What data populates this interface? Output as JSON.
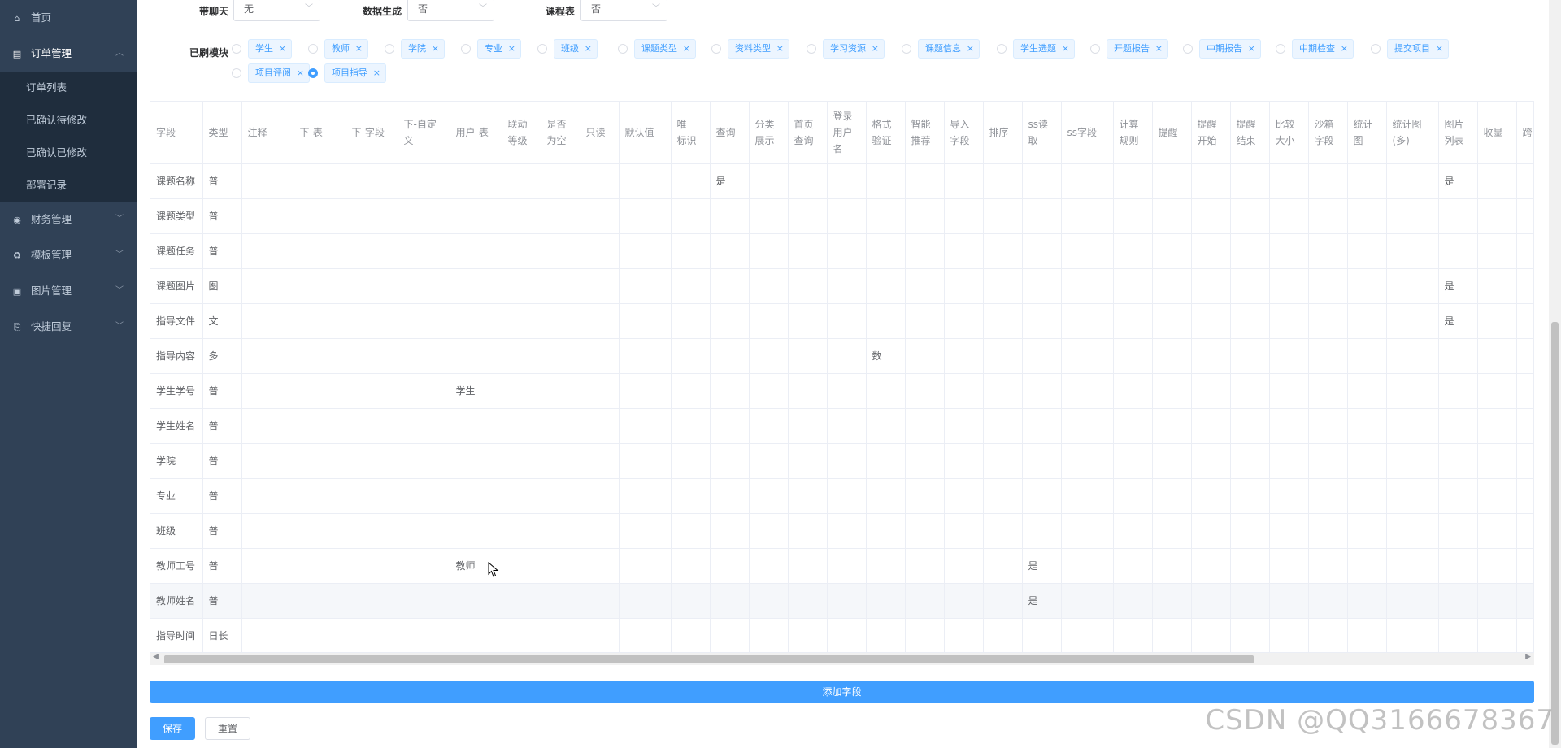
{
  "sidebar": {
    "items": [
      {
        "label": "首页",
        "icon": "home-icon"
      },
      {
        "label": "订单管理",
        "icon": "document-icon",
        "expanded": true,
        "children": [
          "订单列表",
          "已确认待修改",
          "已确认已修改",
          "部署记录"
        ]
      },
      {
        "label": "财务管理",
        "icon": "finance-icon"
      },
      {
        "label": "模板管理",
        "icon": "template-icon"
      },
      {
        "label": "图片管理",
        "icon": "image-icon"
      },
      {
        "label": "快捷回复",
        "icon": "reply-icon"
      }
    ]
  },
  "form": {
    "chat_label": "带聊天",
    "chat_value": "无",
    "datagen_label": "数据生成",
    "datagen_value": "否",
    "schedule_label": "课程表",
    "schedule_value": "否",
    "modules_label": "已刷模块"
  },
  "modules": [
    {
      "label": "学生",
      "checked": false
    },
    {
      "label": "教师",
      "checked": false
    },
    {
      "label": "学院",
      "checked": false
    },
    {
      "label": "专业",
      "checked": false
    },
    {
      "label": "班级",
      "checked": false
    },
    {
      "label": "课题类型",
      "checked": false
    },
    {
      "label": "资料类型",
      "checked": false
    },
    {
      "label": "学习资源",
      "checked": false
    },
    {
      "label": "课题信息",
      "checked": false
    },
    {
      "label": "学生选题",
      "checked": false
    },
    {
      "label": "开题报告",
      "checked": false
    },
    {
      "label": "中期报告",
      "checked": false
    },
    {
      "label": "中期检查",
      "checked": false
    },
    {
      "label": "提交项目",
      "checked": false
    },
    {
      "label": "项目评阅",
      "checked": false
    },
    {
      "label": "项目指导",
      "checked": true
    }
  ],
  "table": {
    "headers": [
      "字段",
      "类型",
      "注释",
      "下-表",
      "下-字段",
      "下-自定义",
      "用户-表",
      "联动等级",
      "是否为空",
      "只读",
      "默认值",
      "唯一标识",
      "查询",
      "分类展示",
      "首页查询",
      "登录用户名",
      "格式验证",
      "智能推荐",
      "导入字段",
      "排序",
      "ss读取",
      "ss字段",
      "计算规则",
      "提醒",
      "提醒开始",
      "提醒结束",
      "比较大小",
      "沙箱字段",
      "统计图",
      "统计图(多)",
      "图片列表",
      "收显",
      "跨计"
    ],
    "rows": [
      [
        "课题名称",
        "普",
        "",
        "",
        "",
        "",
        "",
        "",
        "",
        "",
        "",
        "",
        "是",
        "",
        "",
        "",
        "",
        "",
        "",
        "",
        "",
        "",
        "",
        "",
        "",
        "",
        "",
        "",
        "",
        "",
        "是",
        "",
        ""
      ],
      [
        "课题类型",
        "普",
        "",
        "",
        "",
        "",
        "",
        "",
        "",
        "",
        "",
        "",
        "",
        "",
        "",
        "",
        "",
        "",
        "",
        "",
        "",
        "",
        "",
        "",
        "",
        "",
        "",
        "",
        "",
        "",
        "",
        "",
        ""
      ],
      [
        "课题任务",
        "普",
        "",
        "",
        "",
        "",
        "",
        "",
        "",
        "",
        "",
        "",
        "",
        "",
        "",
        "",
        "",
        "",
        "",
        "",
        "",
        "",
        "",
        "",
        "",
        "",
        "",
        "",
        "",
        "",
        "",
        "",
        ""
      ],
      [
        "课题图片",
        "图",
        "",
        "",
        "",
        "",
        "",
        "",
        "",
        "",
        "",
        "",
        "",
        "",
        "",
        "",
        "",
        "",
        "",
        "",
        "",
        "",
        "",
        "",
        "",
        "",
        "",
        "",
        "",
        "",
        "是",
        "",
        ""
      ],
      [
        "指导文件",
        "文",
        "",
        "",
        "",
        "",
        "",
        "",
        "",
        "",
        "",
        "",
        "",
        "",
        "",
        "",
        "",
        "",
        "",
        "",
        "",
        "",
        "",
        "",
        "",
        "",
        "",
        "",
        "",
        "",
        "是",
        "",
        ""
      ],
      [
        "指导内容",
        "多",
        "",
        "",
        "",
        "",
        "",
        "",
        "",
        "",
        "",
        "",
        "",
        "",
        "",
        "",
        "数",
        "",
        "",
        "",
        "",
        "",
        "",
        "",
        "",
        "",
        "",
        "",
        "",
        "",
        "",
        "",
        ""
      ],
      [
        "学生学号",
        "普",
        "",
        "",
        "",
        "",
        "学生",
        "",
        "",
        "",
        "",
        "",
        "",
        "",
        "",
        "",
        "",
        "",
        "",
        "",
        "",
        "",
        "",
        "",
        "",
        "",
        "",
        "",
        "",
        "",
        "",
        "",
        ""
      ],
      [
        "学生姓名",
        "普",
        "",
        "",
        "",
        "",
        "",
        "",
        "",
        "",
        "",
        "",
        "",
        "",
        "",
        "",
        "",
        "",
        "",
        "",
        "",
        "",
        "",
        "",
        "",
        "",
        "",
        "",
        "",
        "",
        "",
        "",
        ""
      ],
      [
        "学院",
        "普",
        "",
        "",
        "",
        "",
        "",
        "",
        "",
        "",
        "",
        "",
        "",
        "",
        "",
        "",
        "",
        "",
        "",
        "",
        "",
        "",
        "",
        "",
        "",
        "",
        "",
        "",
        "",
        "",
        "",
        "",
        ""
      ],
      [
        "专业",
        "普",
        "",
        "",
        "",
        "",
        "",
        "",
        "",
        "",
        "",
        "",
        "",
        "",
        "",
        "",
        "",
        "",
        "",
        "",
        "",
        "",
        "",
        "",
        "",
        "",
        "",
        "",
        "",
        "",
        "",
        "",
        ""
      ],
      [
        "班级",
        "普",
        "",
        "",
        "",
        "",
        "",
        "",
        "",
        "",
        "",
        "",
        "",
        "",
        "",
        "",
        "",
        "",
        "",
        "",
        "",
        "",
        "",
        "",
        "",
        "",
        "",
        "",
        "",
        "",
        "",
        "",
        ""
      ],
      [
        "教师工号",
        "普",
        "",
        "",
        "",
        "",
        "教师",
        "",
        "",
        "",
        "",
        "",
        "",
        "",
        "",
        "",
        "",
        "",
        "",
        "",
        "是",
        "",
        "",
        "",
        "",
        "",
        "",
        "",
        "",
        "",
        "",
        "",
        ""
      ],
      [
        "教师姓名",
        "普",
        "",
        "",
        "",
        "",
        "",
        "",
        "",
        "",
        "",
        "",
        "",
        "",
        "",
        "",
        "",
        "",
        "",
        "",
        "是",
        "",
        "",
        "",
        "",
        "",
        "",
        "",
        "",
        "",
        "",
        "",
        ""
      ],
      [
        "指导时间",
        "日长",
        "",
        "",
        "",
        "",
        "",
        "",
        "",
        "",
        "",
        "",
        "",
        "",
        "",
        "",
        "",
        "",
        "",
        "",
        "",
        "",
        "",
        "",
        "",
        "",
        "",
        "",
        "",
        "",
        "",
        "",
        ""
      ]
    ]
  },
  "buttons": {
    "add_field": "添加字段",
    "save": "保存",
    "reset": "重置"
  },
  "watermark": "CSDN @QQ3166678367",
  "colors": {
    "sidebar_bg": "#304156",
    "primary": "#409eff"
  }
}
